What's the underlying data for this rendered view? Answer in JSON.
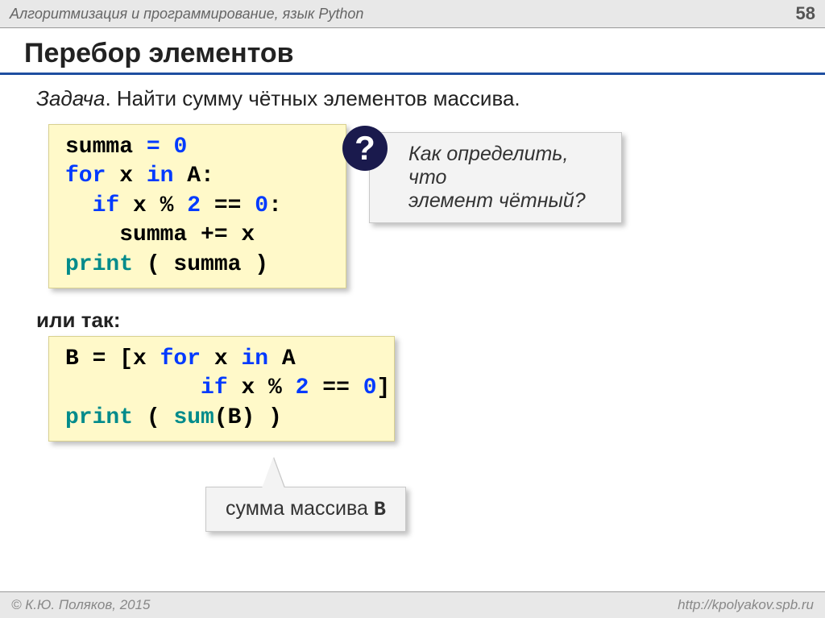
{
  "header": {
    "course": "Алгоритмизация и программирование, язык Python",
    "page": "58"
  },
  "title": "Перебор элементов",
  "task": {
    "label": "Задача",
    "text": ". Найти сумму чётных элементов массива."
  },
  "code1": {
    "l1a": "summa",
    "l1b": "=",
    "l1c": "0",
    "l2a": "for",
    "l2b": " x ",
    "l2c": "in",
    "l2d": " A:",
    "l3a": "  ",
    "l3b": "if",
    "l3c": " x % ",
    "l3d": "2",
    "l3e": " == ",
    "l3f": "0",
    "l3g": ":",
    "l4": "    summa += x",
    "l5a": "print",
    "l5b": " ( summa )"
  },
  "question": {
    "icon": "?",
    "line1": "Как определить, что",
    "line2": "элемент чётный?"
  },
  "or_label": "или так:",
  "code2": {
    "l1a": "B = [x ",
    "l1b": "for",
    "l1c": " x ",
    "l1d": "in",
    "l1e": " A",
    "l2a": "          ",
    "l2b": "if",
    "l2c": " x % ",
    "l2d": "2",
    "l2e": " == ",
    "l2f": "0",
    "l2g": "]",
    "l3a": "print",
    "l3b": " ( ",
    "l3c": "sum",
    "l3d": "(B) )"
  },
  "callout": {
    "text": "сумма массива ",
    "code": "B"
  },
  "footer": {
    "copyright": "© К.Ю. Поляков, 2015",
    "url": "http://kpolyakov.spb.ru"
  }
}
